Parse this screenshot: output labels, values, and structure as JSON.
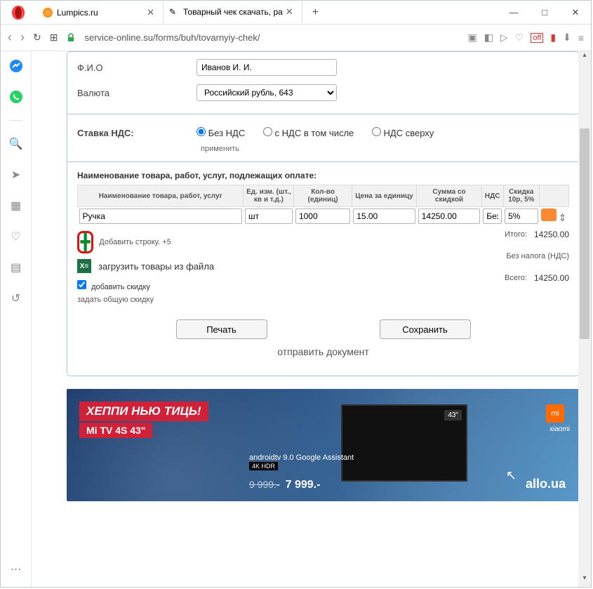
{
  "tabs": [
    {
      "title": "Lumpics.ru",
      "favicon": "orange"
    },
    {
      "title": "Товарный чек скачать, ра",
      "favicon": "pencil"
    }
  ],
  "new_tab": "+",
  "win": {
    "min": "―",
    "max": "□",
    "close": "✕"
  },
  "toolbar": {
    "back": "‹",
    "forward": "›",
    "reload": "↻",
    "url": "service-online.su/forms/buh/tovarnyiy-chek/",
    "speeddial": "⊞"
  },
  "form": {
    "fio_label": "Ф.И.О",
    "fio_value": "Иванов И. И.",
    "currency_label": "Валюта",
    "currency_value": "Российский рубль, 643",
    "vat_label": "Ставка НДС:",
    "vat_options": [
      "Без НДС",
      "с НДС в том числе",
      "НДС сверху"
    ],
    "apply": "применить",
    "table_title": "Наименование товара, работ, услуг, подлежащих оплате:",
    "headers": {
      "name": "Наименование товара, работ, услуг",
      "unit": "Ед. изм. (шт., кв и т.д.)",
      "qty": "Кол-во (единиц)",
      "price": "Цена за единицу",
      "sum": "Сумма со скидкой",
      "vat": "НДС",
      "disc": "Скидка 10р, 5%"
    },
    "row": {
      "name": "Ручка",
      "unit": "шт",
      "qty": "1000",
      "price": "15.00",
      "sum": "14250.00",
      "vat": "Без",
      "disc": "5%"
    },
    "add_row": "Добавить строку.",
    "add_row_plus": "+5",
    "upload": "загрузить товары из файла",
    "add_discount": "добавить скидку",
    "set_discount": "задать общую скидку",
    "totals": {
      "itogo_k": "Итого:",
      "itogo_v": "14250.00",
      "novat": "Без налога (НДС)",
      "vsego_k": "Всего:",
      "vsego_v": "14250.00"
    },
    "btn_print": "Печать",
    "btn_save": "Сохранить",
    "send": "отправить документ"
  },
  "ad": {
    "line1": "ХЕППИ НЬЮ ТИЦЬ!",
    "line2": "Mi TV 4S 43\"",
    "android": "androidtv 9.0  Google Assistant",
    "hdr": "4K HDR",
    "old_price": "9 999.-",
    "new_price": "7 999.-",
    "brand": "xiaomi",
    "allo": "allo.ua",
    "logo": "mi"
  }
}
